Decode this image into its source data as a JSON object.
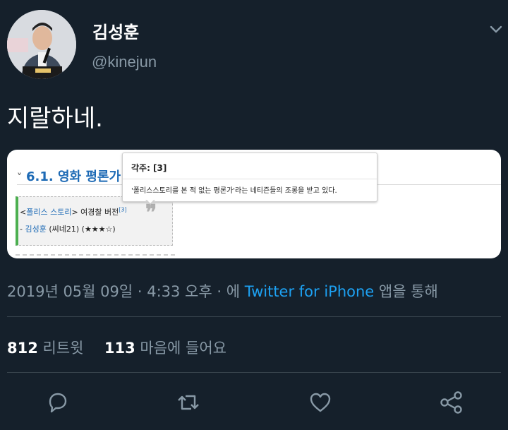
{
  "author": {
    "display_name": "김성훈",
    "handle": "@kinejun",
    "avatar_icon": "avatar"
  },
  "tweet": {
    "text": "지랄하네."
  },
  "media": {
    "heading_arrow": "˅",
    "heading": "6.1. 영화 평론가",
    "quote": {
      "prefix": "<",
      "title_link": "폴리스 스토리",
      "suffix_text": "> 여경찰 버전",
      "footnote_ref": "[3]",
      "dash": "- ",
      "critic_link": "김성훈",
      "source": " (씨네21) (★★★☆)"
    },
    "tooltip": {
      "title": "각주: [3]",
      "body": "'폴리스스토리를 본 적 없는 평론가'라는 네티즌들의 조롱을 받고 있다."
    }
  },
  "meta": {
    "timestamp": "2019년 05월 09일 · 4:33 오후 · 에 ",
    "source_app": "Twitter for iPhone",
    "suffix": " 앱을 통해"
  },
  "stats": {
    "retweet_count": "812",
    "retweet_label": " 리트윗",
    "like_count": "113",
    "like_label": " 마음에 들어요"
  },
  "colors": {
    "background": "#15202b",
    "secondary_text": "#8899a6",
    "link": "#1da1f2",
    "divider": "#38444d"
  }
}
